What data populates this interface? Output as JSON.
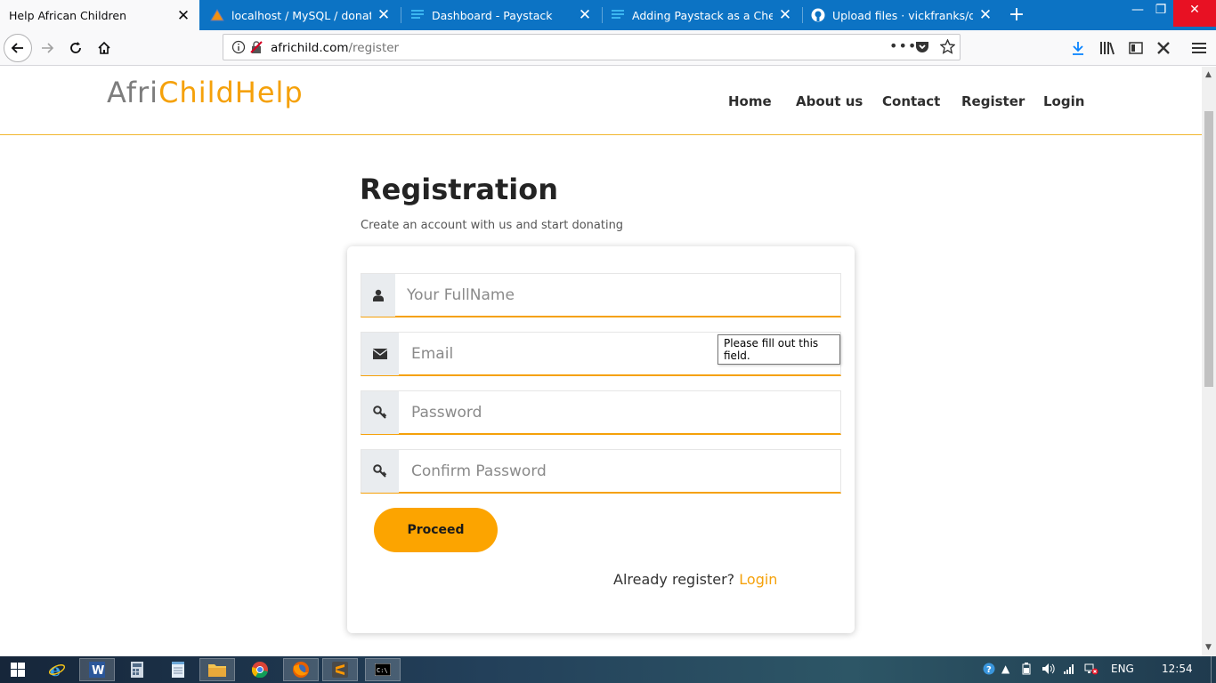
{
  "browser": {
    "tabs": [
      {
        "title": "Help African Children",
        "active": true,
        "icon": "none"
      },
      {
        "title": "localhost / MySQL / donation |",
        "active": false,
        "icon": "phpmyadmin-icon"
      },
      {
        "title": "Dashboard - Paystack",
        "active": false,
        "icon": "paystack-icon"
      },
      {
        "title": "Adding Paystack as a Checkout",
        "active": false,
        "icon": "paystack-icon"
      },
      {
        "title": "Upload files · vickfranks/donati",
        "active": false,
        "icon": "github-icon"
      }
    ],
    "url": {
      "domain": "africhild.com",
      "path": "/register"
    }
  },
  "site": {
    "logo_part1": "Afri",
    "logo_part2": "ChildHelp",
    "nav": [
      "Home",
      "About us",
      "Contact",
      "Register",
      "Login"
    ]
  },
  "registration": {
    "title": "Registration",
    "subtitle": "Create an account with us and start donating",
    "fields": {
      "fullname_placeholder": "Your FullName",
      "email_placeholder": "Email",
      "password_placeholder": "Password",
      "confirm_placeholder": "Confirm Password"
    },
    "tooltip": "Please fill out this field.",
    "proceed_label": "Proceed",
    "already_text": "Already register?",
    "login_link": "Login"
  },
  "taskbar": {
    "language": "ENG",
    "time": "12:54"
  },
  "colors": {
    "accent": "#f5a10a",
    "button": "#fca400",
    "tabbar": "#0c73c4"
  }
}
